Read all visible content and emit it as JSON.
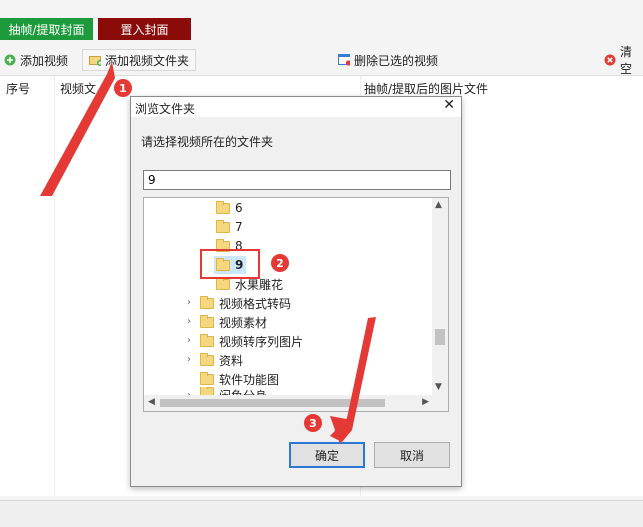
{
  "modes": {
    "extract_label": "抽帧/提取封面",
    "cover_label": "置入封面"
  },
  "toolbar": {
    "add_video": "添加视频",
    "add_folder": "添加视频文件夹",
    "delete_selected": "删除已选的视频",
    "clear": "清空"
  },
  "list": {
    "col_index": "序号",
    "col_video": "视频文",
    "col_output": "抽帧/提取后的图片文件"
  },
  "dialog": {
    "title": "浏览文件夹",
    "close": "✕",
    "prompt": "请选择视频所在的文件夹",
    "path_value": "9",
    "tree": [
      {
        "label": "6"
      },
      {
        "label": "7"
      },
      {
        "label": "8"
      },
      {
        "label": "9",
        "selected": true
      },
      {
        "label": "水果雕花"
      },
      {
        "label": "视频格式转码"
      },
      {
        "label": "视频素材"
      },
      {
        "label": "视频转序列图片"
      },
      {
        "label": "资料"
      },
      {
        "label": "软件功能图"
      },
      {
        "label": "闲鱼分身"
      }
    ],
    "ok": "确定",
    "cancel": "取消"
  },
  "annotations": [
    "1",
    "2",
    "3"
  ],
  "colors": {
    "extract_bg": "#1c9a3c",
    "cover_bg": "#8b0a0a",
    "accent_red": "#e53935",
    "selected_blue": "#cce8ff"
  }
}
